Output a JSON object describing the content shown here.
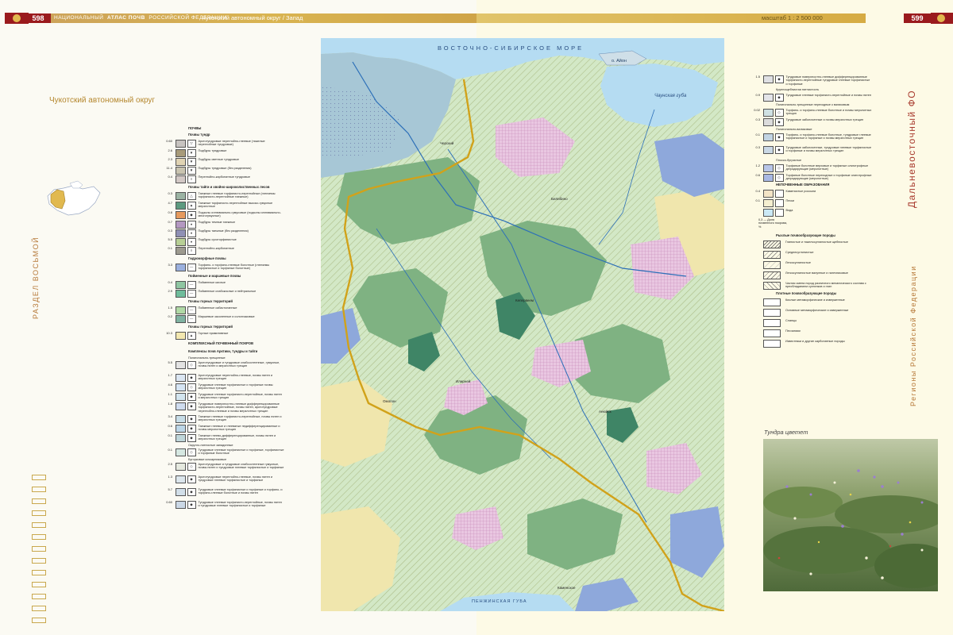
{
  "header": {
    "left_page_number": "598",
    "left_running_head_1": "НАЦИОНАЛЬНЫЙ",
    "left_running_head_2": "АТЛАС ПОЧВ",
    "left_running_head_3": "РОССИЙСКОЙ ФЕДЕРАЦИИ",
    "map_title": "Чукотский автономный округ / Запад",
    "scale": "масштаб 1 : 2 500 000",
    "right_page_number": "599"
  },
  "left_page": {
    "region_title": "Чукотский автономный округ",
    "section_label": "РАЗДЕЛ ВОСЬМОЙ"
  },
  "right_page": {
    "side_title_1": "Дальневосточный ФО",
    "side_title_2": "Регионы Российской Федерации"
  },
  "map": {
    "sea_label": "ВОСТОЧНО-СИБИРСКОЕ МОРЕ",
    "bay_bottom": "ПЕНЖИНСКАЯ ГУБА",
    "bay_chaun": "Чаунская губа",
    "island_aion": "о. Айон",
    "colors": {
      "tundra": "#d3e8c6",
      "forest": "#7fb282",
      "dark_forest": "#3f8566",
      "wetland": "#8ea8db",
      "mountain": "#f0e6ad",
      "meadow": "#e9c7e1",
      "water": "#b5dcf2",
      "border": "#d1a21a",
      "river": "#2c6fb8"
    }
  },
  "legend_left": {
    "title": "ПОЧВЫ",
    "groups": [
      {
        "head": "Почвы тундр",
        "items": [
          {
            "pct": "0.60",
            "text": "Арктотундровые перегнойно-глеевые (тяжелые перегнойные тундровые)",
            "color": "#c7c3c0",
            "sym": "▽"
          },
          {
            "pct": "2.6",
            "text": "Подбуры тундровые",
            "color": "#a89b7a",
            "sym": "▼"
          },
          {
            "pct": "2.3",
            "text": "Подбуры светлые тундровые",
            "color": "#e0d3b3",
            "sym": "▼"
          },
          {
            "pct": "11.4",
            "text": "Подбуры тундровые (без разделения)",
            "color": "#c9c4b0",
            "sym": "▼"
          },
          {
            "pct": "0.4",
            "text": "Перегнойно-карбонатные тундровые",
            "color": "#d2c8c5",
            "sym": "◊"
          }
        ]
      },
      {
        "head": "Почвы тайги и хвойно-широколиственных лесов",
        "items": [
          {
            "pct": "0.3",
            "text": "Таежные глеевые торфянисто-перегнойные (глееземы торфянисто-перегнойные таежные)",
            "color": "#9cb4a4",
            "sym": "△"
          },
          {
            "pct": "4.7",
            "text": "Таежные торфянисто-перегнойные высоко-гумусные мерзлотные",
            "color": "#5d9a80",
            "sym": "▲"
          },
          {
            "pct": "0.8",
            "text": "Подзолы иллювиально-гумусовые (подзолы иллювиально-многогумусные)",
            "color": "#e69a5e",
            "sym": "◆"
          },
          {
            "pct": "0.7",
            "text": "Подбуры темные таежные",
            "color": "#b498c2",
            "sym": "♦"
          },
          {
            "pct": "0.3",
            "text": "Подбуры таежные (без разделения)",
            "color": "#8f90b5",
            "sym": "♦"
          },
          {
            "pct": "5.5",
            "text": "Подбуры сухоторфянистые",
            "color": "#b7cf95",
            "sym": "♦"
          },
          {
            "pct": "0.1",
            "text": "Перегнойно-карбонатные",
            "color": "#9d9a8f",
            "sym": "◊"
          }
        ]
      },
      {
        "head": "Гидроморфные почвы",
        "items": [
          {
            "pct": "3.3",
            "text": "Торфяно- и торфяно-глеевые болотные (глееземы торфянистые и торфяные болотные)",
            "color": "#9bb0de",
            "sym": "—"
          }
        ]
      },
      {
        "head": "Пойменные и маршевые почвы",
        "items": [
          {
            "pct": "0.4",
            "text": "Пойменные кислые",
            "color": "#8fc6a2",
            "sym": "—"
          },
          {
            "pct": "2.9",
            "text": "Пойменные слабокислые и нейтральные",
            "color": "#6fbc9b",
            "sym": "—"
          }
        ]
      },
      {
        "head": "Почвы горных территорий",
        "items": [
          {
            "pct": "1.5",
            "text": "Пойменные сабастоланные",
            "color": "#b0d9a5",
            "sym": "—"
          },
          {
            "pct": "0.2",
            "text": "Маршевые засоленные и солончаковые",
            "color": "#7fb2a1",
            "sym": "—"
          }
        ]
      },
      {
        "head": "Почвы горных территорий",
        "items": [
          {
            "pct": "10.3",
            "text": "Горные примитивные",
            "color": "#f3e8b0",
            "sym": "▲"
          }
        ]
      },
      {
        "head": "КОМПЛЕКСНЫЙ ПОЧВЕННЫЙ ПОКРОВ",
        "items": []
      },
      {
        "head": "Комплексы почв Арктики, тундры и тайги",
        "items": [
          {
            "pct": "",
            "text": "Полигонально-трещинные",
            "color": "",
            "sym": ""
          },
          {
            "pct": "5.5",
            "text": "Арктотундровые и тундровые слабоостеенные, гумусные, почвы пятен и мерзлотных трещин",
            "color": "#e3e3e3",
            "sym": "◇"
          },
          {
            "pct": "1.7",
            "text": "Арктотундровые перегнойно-глеевые, почвы пятен и мерзлотных трещин",
            "color": "#dbe6f2",
            "sym": "◆"
          },
          {
            "pct": "4.6",
            "text": "Тундровые глеевые торфянистые и торфяные почвы мерзлотных трещин",
            "color": "#d6e5f4",
            "sym": "◇"
          },
          {
            "pct": "1.1",
            "text": "Тундровые глеевые торфянисто-перегнойные, почвы пятен и мерзлотных трещин",
            "color": "#d3e5ef",
            "sym": "◆"
          },
          {
            "pct": "1.8",
            "text": "Тундровые поверхностно-глеевые дифференцированные торфянисто-перегнойные, почвы пятен, арктотундровые перегнойно-глеевые и почвы мерзлотных трещин",
            "color": "#cfdcef",
            "sym": "◆"
          },
          {
            "pct": "3.4",
            "text": "Таежные глеевые торфянисто-перегнойные, почвы пятен и мерзлотных трещин",
            "color": "#c7dde7",
            "sym": "◆"
          },
          {
            "pct": "0.6",
            "text": "Таежные глеевые и глееватые недифференцированные и почвы мерзлотных трещин",
            "color": "#bcd6e7",
            "sym": "◆"
          },
          {
            "pct": "0.1",
            "text": "Таежные глеево-дифференцированные, почвы пятен и мерзлотных трещин",
            "color": "#bfd6da",
            "sym": "◆"
          },
          {
            "pct": "",
            "text": "Округло-пятнистые западинные",
            "color": "",
            "sym": ""
          },
          {
            "pct": "0.1",
            "text": "Тундровые глеевые торфянистые и торфяные, торфянистые и торфяные болотные",
            "color": "#d6e8e2",
            "sym": "◇"
          },
          {
            "pct": "",
            "text": "Бугорковые кочкарниковые",
            "color": "",
            "sym": ""
          },
          {
            "pct": "2.5",
            "text": "Арктотундровые и тундровые слабоостеенные гумусные, почвы пятен и тундровые глеевые торфянистые и торфяные",
            "color": "#e5e9df",
            "sym": "◇"
          },
          {
            "pct": "1.3",
            "text": "Арктотундровые перегнойно-глеевые, почвы пятен и тундровые глеевые торфянистые и торфяные",
            "color": "#dce6ec",
            "sym": "◆"
          },
          {
            "pct": "5.7",
            "text": "Тундровые глеевые торфянистые и торфяные и торфяно- и торфяно-глеевые болотные и почвы пятен",
            "color": "#d2dfe9",
            "sym": "◆"
          },
          {
            "pct": "0.60",
            "text": "Тундровые глеевые торфянисто-перегнойные, почвы пятен и тундровые глеевые торфянистые и торфяные",
            "color": "#cbd8e6",
            "sym": "◆"
          }
        ]
      }
    ]
  },
  "legend_right": {
    "items": [
      {
        "pct": "1.5",
        "text": "Тундровые поверхностно-глеевые дифференцированные торфянисто-перегнойные тундровые глеевые торфянистые и торфяные",
        "color": "#dfe0e3",
        "sym": "◆"
      },
      {
        "pct": "",
        "text": "Крупнощебнистая пятнистость",
        "color": "",
        "sym": ""
      },
      {
        "pct": "0.9",
        "text": "Тундровые глеевые торфянисто-перегнойные и почвы пятен",
        "color": "#e3e4e8",
        "sym": "◆"
      },
      {
        "pct": "",
        "text": "Полигонально-трещинные переходные к валиковым",
        "color": "",
        "sym": ""
      },
      {
        "pct": "0.02",
        "text": "Торфяно- и торфяно-глеевые болотные и почвы мерзлотных трещин",
        "color": "#cfe1e3",
        "sym": "◇"
      },
      {
        "pct": "0.3",
        "text": "Тундровые заболоченные и почвы мерзлотных трещин",
        "color": "#dcdcdc",
        "sym": "◆"
      },
      {
        "pct": "",
        "text": "Полигонально-валиковые",
        "color": "",
        "sym": ""
      },
      {
        "pct": "0.1",
        "text": "Торфяно- и торфяно-глеевые болотные, тундровые глеевые торфянистые и торфяные и почвы мерзлотных трещин",
        "color": "#c2d4e3",
        "sym": "◆"
      },
      {
        "pct": "0.3",
        "text": "Тундровые заболоченные, тундровые глеевые торфянистые и торфяные и почвы мерзлотных трещин",
        "color": "#cad8e5",
        "sym": "◆"
      },
      {
        "pct": "",
        "text": "Плоско-бугристые",
        "color": "",
        "sym": ""
      },
      {
        "pct": "1.2",
        "text": "Торфяные болотные верховые и торфяные олиготрофные деградирующие (мерзлотные)",
        "color": "#b8c6e8",
        "sym": "◇"
      },
      {
        "pct": "0.6",
        "text": "Торфяные болотные переходные и торфяные олиготрофные деградирующие (мерзлотные)",
        "color": "#a8b8e3",
        "sym": "◇"
      }
    ],
    "nonsoil_head": "НЕПОЧВЕННЫЕ ОБРАЗОВАНИЯ",
    "nonsoil": [
      {
        "pct": "0.4",
        "text": "Каменистые россыпи",
        "color": "#f3e4c6",
        "sym": ""
      },
      {
        "pct": "0.1",
        "text": "Пески",
        "color": "#f5efd0",
        "sym": ""
      },
      {
        "pct": "",
        "text": "Вода",
        "color": "#cbe9f5",
        "sym": ""
      }
    ],
    "share_label": "0,3 — Доля почвенного покрова, %",
    "rocks_head": "Рыхлые почвообразующие породы",
    "rocks": [
      "Глинистые и тяжелосуглинистые щебнистые",
      "Среднесуглинистые",
      "Легкосуглинистые",
      "Легкосуглинистые валунные и галечниковые",
      "Частая смена пород различного механического состава с преобладанием суглинков и глин"
    ],
    "solid_head": "Плотные почвообразующие породы",
    "solid": [
      "Кислые метаморфические и изверженные",
      "Основные метаморфические и изверженные",
      "Сланцы",
      "Песчаники",
      "Известняки и другие карбонатные породы"
    ]
  },
  "photo": {
    "caption": "Тундра цветет"
  },
  "map_places": [
    "Чукотский",
    "Черский",
    "Билибино",
    "Кепервеем",
    "Омолон",
    "Анюйск",
    "Илирней",
    "Каменское"
  ]
}
